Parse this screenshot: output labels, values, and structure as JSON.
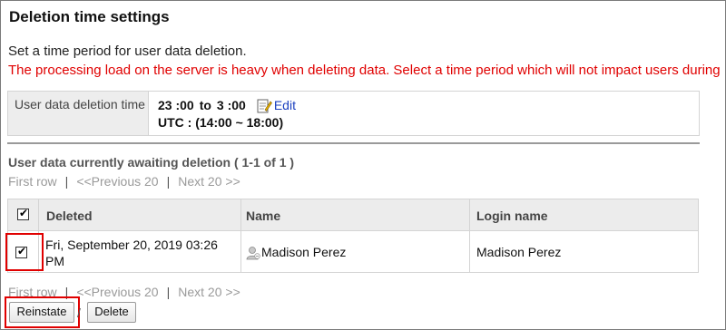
{
  "page": {
    "title": "Deletion time settings",
    "description": "Set a time period for user data deletion.",
    "warning": "The processing load on the server is heavy when deleting data. Select a time period which will not impact users during"
  },
  "settings": {
    "label": "User data deletion time",
    "start": "23 :00",
    "to": "to",
    "end": "3 :00",
    "edit_label": "Edit",
    "utc": "UTC : (14:00 ~ 18:00)"
  },
  "list": {
    "heading": "User data currently awaiting deletion ( 1-1 of 1 )",
    "pager": {
      "first": "First row",
      "previous": "<<Previous 20",
      "next": "Next 20 >>",
      "separator": "|"
    },
    "columns": [
      "Deleted",
      "Name",
      "Login name"
    ],
    "rows": [
      {
        "checked": true,
        "deleted": "Fri, September 20, 2019 03:26 PM",
        "name": "Madison Perez",
        "login": "Madison Perez"
      }
    ],
    "select_all_checked": true
  },
  "actions": {
    "reinstate": "Reinstate",
    "separator": "/",
    "delete": "Delete"
  },
  "colors": {
    "warning": "#e00000",
    "highlight": "#e00000",
    "link": "#1a3fbf",
    "pager_disabled": "#9a9a9a"
  }
}
